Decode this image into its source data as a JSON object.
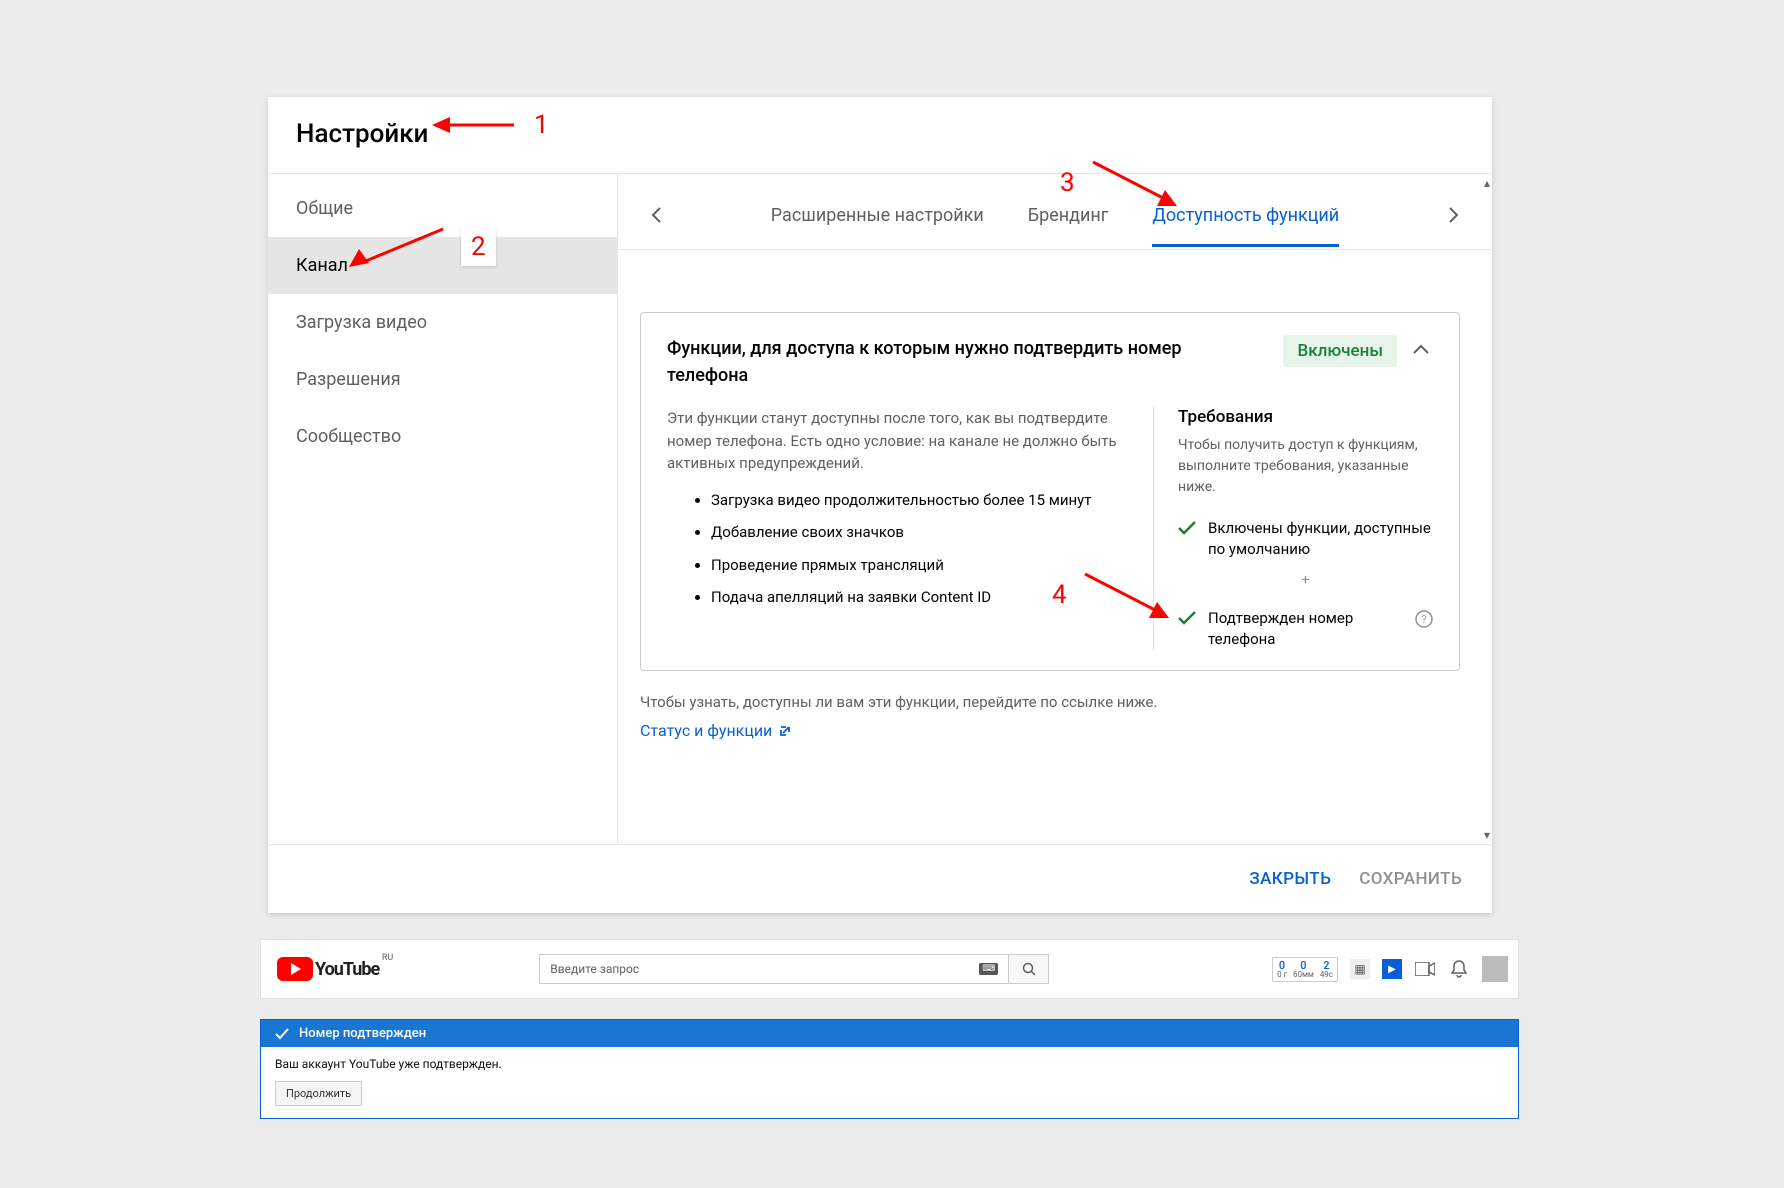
{
  "dialog": {
    "title": "Настройки",
    "sidebar": [
      {
        "label": "Общие",
        "active": false
      },
      {
        "label": "Канал",
        "active": true
      },
      {
        "label": "Загрузка видео",
        "active": false
      },
      {
        "label": "Разрешения",
        "active": false
      },
      {
        "label": "Сообщество",
        "active": false
      }
    ],
    "tabs": [
      {
        "label": "Расширенные настройки",
        "active": false
      },
      {
        "label": "Брендинг",
        "active": false
      },
      {
        "label": "Доступность функций",
        "active": true
      }
    ],
    "card": {
      "title": "Функции, для доступа к которым нужно подтвердить номер телефона",
      "status": "Включены",
      "desc": "Эти функции станут доступны после того, как вы подтвердите номер телефона. Есть одно условие: на канале не должно быть активных предупреждений.",
      "features": [
        "Загрузка видео продолжительностью более 15 минут",
        "Добавление своих значков",
        "Проведение прямых трансляций",
        "Подача апелляций на заявки Content ID"
      ],
      "reqTitle": "Требования",
      "reqDesc": "Чтобы получить доступ к функциям, выполните требования, указанные ниже.",
      "req1": "Включены функции, доступные по умолчанию",
      "req2": "Подтвержден номер телефона",
      "plus": "+"
    },
    "footnote": "Чтобы узнать, доступны ли вам эти функции, перейдите по ссылке ниже.",
    "link": "Статус и функции",
    "close": "ЗАКРЫТЬ",
    "save": "СОХРАНИТЬ"
  },
  "annotations": {
    "n1": "1",
    "n2": "2",
    "n3": "3",
    "n4": "4"
  },
  "yt": {
    "brand": "YouTube",
    "region": "RU",
    "searchPlaceholder": "Введите запрос",
    "stats": [
      {
        "top": "0",
        "bot": "0 г"
      },
      {
        "top": "0",
        "bot": "60мм"
      },
      {
        "top": "2",
        "bot": "49с"
      }
    ],
    "bannerTitle": "Номер подтвержден",
    "bannerBody": "Ваш аккаунт YouTube уже подтвержден.",
    "continue": "Продолжить"
  }
}
